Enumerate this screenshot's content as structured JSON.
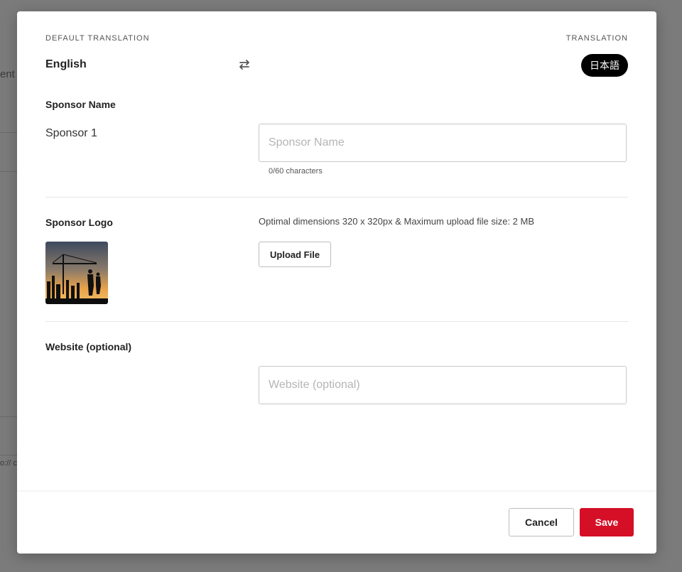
{
  "background_page": {
    "fragment_top": "ent",
    "fragment_bottom": "o:// c"
  },
  "modal": {
    "default_translation_label": "DEFAULT TRANSLATION",
    "translation_label": "TRANSLATION",
    "source_language": "English",
    "target_language": "日本語",
    "swap_icon": "swap-arrows-icon",
    "sponsor_name": {
      "title": "Sponsor Name",
      "source_value": "Sponsor 1",
      "placeholder": "Sponsor Name",
      "value": "",
      "char_count": "0/60 characters"
    },
    "sponsor_logo": {
      "title": "Sponsor Logo",
      "hint": "Optimal dimensions 320 x 320px & Maximum upload file size: 2 MB",
      "upload_label": "Upload File"
    },
    "website": {
      "title": "Website (optional)",
      "placeholder": "Website (optional)",
      "value": ""
    },
    "footer": {
      "cancel_label": "Cancel",
      "save_label": "Save"
    }
  },
  "colors": {
    "accent_save": "#d40f26",
    "pill_bg": "#000000",
    "backdrop": "#7b7b7b"
  }
}
